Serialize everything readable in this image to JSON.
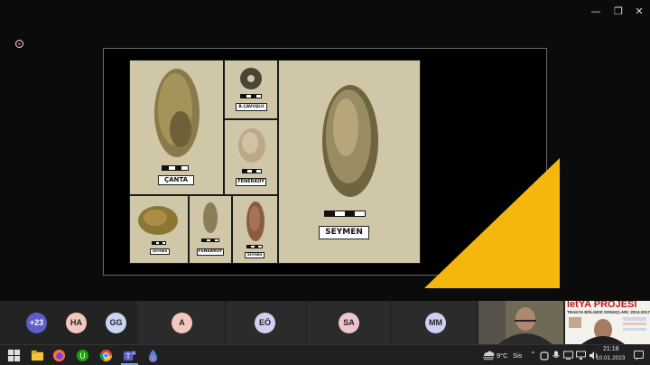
{
  "window": {
    "controls": [
      "—",
      "❐",
      "✕"
    ]
  },
  "slide": {
    "labels": {
      "canta": "ÇANTA",
      "b_cavuslu": "B.ÇAVUŞLU",
      "fenerkoy_1": "FENERKÖY",
      "seymen_large": "SEYMEN",
      "seymen_small": "SEYMEN",
      "fenerkoy_2": "FENERKÖY",
      "seymen_small2": "SEYMEN"
    },
    "accent_color": "#f5b60d"
  },
  "participants": {
    "items": [
      {
        "initials": "+23",
        "color": "#5b5fc7",
        "text_color": "#ffffff"
      },
      {
        "initials": "HA",
        "color": "#f3c7bd",
        "text_color": "#222222"
      },
      {
        "initials": "GG",
        "color": "#c7d7ef",
        "text_color": "#222222"
      },
      {
        "initials": "A",
        "color": "#f3c7bd",
        "text_color": "#222222"
      },
      {
        "initials": "EÖ",
        "color": "#d2cff0",
        "text_color": "#222222"
      },
      {
        "initials": "SA",
        "color": "#f0c4cc",
        "text_color": "#222222"
      },
      {
        "initials": "MM",
        "color": "#cdd0f0",
        "text_color": "#222222"
      }
    ],
    "presentation_title": "letYA PROJESİ",
    "presentation_subtitle": "TRAKYA BÖLGESİ SONUÇLARI: 2013-2017"
  },
  "taskbar": {
    "weather": "9°C",
    "weather_desc": "Sis",
    "time": "21:18",
    "date": "10.01.2023",
    "apps": [
      "windows-start",
      "file-explorer",
      "firefox",
      "upwork",
      "chrome",
      "teams",
      "edge-drop"
    ]
  }
}
